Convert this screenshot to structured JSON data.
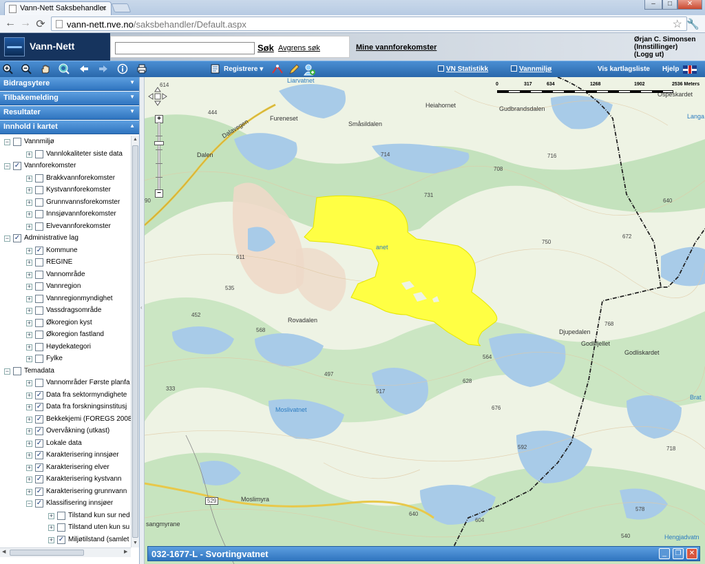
{
  "browser": {
    "tab_title": "Vann-Nett Saksbehandler",
    "tab_close": "×",
    "url_host": "vann-nett.nve.no",
    "url_path": "/saksbehandler/Default.aspx",
    "win_min": "–",
    "win_max": "□",
    "win_close": "✕",
    "back": "←",
    "forward": "→",
    "reload": "⟳",
    "star": "☆",
    "wrench": "🔧"
  },
  "header": {
    "logo_text": "Vann-Nett",
    "search_value": "",
    "search_button": "Søk",
    "refine_link": "Avgrens søk",
    "mine_link": "Mine vannforekomster",
    "user_name": "Ørjan C. Simonsen",
    "user_settings": "(Innstillinger)",
    "user_logout": "(Logg ut)"
  },
  "toolbar": {
    "registrere": "Registrere",
    "vn_statistikk": "VN Statistikk",
    "vannmiljo": "Vannmiljø",
    "vis_kartlagsliste": "Vis kartlagsliste",
    "hjelp": "Hjelp"
  },
  "accordion": [
    {
      "label": "Bidragsytere"
    },
    {
      "label": "Tilbakemelding"
    },
    {
      "label": "Resultater"
    },
    {
      "label": "Innhold i kartet"
    }
  ],
  "tree": [
    {
      "label": "Vannmiljø",
      "level": 0,
      "checked": false
    },
    {
      "label": "Vannlokaliteter siste data",
      "level": 1,
      "checked": false
    },
    {
      "label": "Vannforekomster",
      "level": 0,
      "checked": true
    },
    {
      "label": "Brakkvannforekomster",
      "level": 1,
      "checked": false
    },
    {
      "label": "Kystvannforekomster",
      "level": 1,
      "checked": false
    },
    {
      "label": "Grunnvannsforekomster",
      "level": 1,
      "checked": false
    },
    {
      "label": "Innsjøvannforekomster",
      "level": 1,
      "checked": false
    },
    {
      "label": "Elvevannforekomster",
      "level": 1,
      "checked": false
    },
    {
      "label": "Administrative lag",
      "level": 0,
      "checked": true
    },
    {
      "label": "Kommune",
      "level": 1,
      "checked": true
    },
    {
      "label": "REGINE",
      "level": 1,
      "checked": false
    },
    {
      "label": "Vannområde",
      "level": 1,
      "checked": false
    },
    {
      "label": "Vannregion",
      "level": 1,
      "checked": false
    },
    {
      "label": "Vannregionmyndighet",
      "level": 1,
      "checked": false
    },
    {
      "label": "Vassdragsområde",
      "level": 1,
      "checked": false
    },
    {
      "label": "Økoregion kyst",
      "level": 1,
      "checked": false
    },
    {
      "label": "Økoregion fastland",
      "level": 1,
      "checked": false
    },
    {
      "label": "Høydekategori",
      "level": 1,
      "checked": false
    },
    {
      "label": "Fylke",
      "level": 1,
      "checked": false
    },
    {
      "label": "Temadata",
      "level": 0,
      "checked": false
    },
    {
      "label": "Vannområder Første planfa",
      "level": 1,
      "checked": false
    },
    {
      "label": "Data fra sektormyndighete",
      "level": 1,
      "checked": true
    },
    {
      "label": "Data fra forskningsinstitusj",
      "level": 1,
      "checked": true
    },
    {
      "label": "Bekkekjemi (FOREGS 2008",
      "level": 1,
      "checked": true
    },
    {
      "label": "Overvåkning (utkast)",
      "level": 1,
      "checked": true
    },
    {
      "label": "Lokale data",
      "level": 1,
      "checked": true
    },
    {
      "label": "Karakterisering innsjøer",
      "level": 1,
      "checked": true
    },
    {
      "label": "Karakterisering elver",
      "level": 1,
      "checked": true
    },
    {
      "label": "Karakterisering kystvann",
      "level": 1,
      "checked": true
    },
    {
      "label": "Karakterisering grunnvann",
      "level": 1,
      "checked": true
    },
    {
      "label": "Klassifisering innsjøer",
      "level": 1,
      "checked": true,
      "expanded": true
    },
    {
      "label": "Tilstand kun sur ned",
      "level": 2,
      "checked": false
    },
    {
      "label": "Tilstand uten kun su",
      "level": 2,
      "checked": false
    },
    {
      "label": "Miljøtilstand (samlet",
      "level": 2,
      "checked": true
    }
  ],
  "map": {
    "scale_labels": [
      "0",
      "317",
      "634",
      "1268",
      "1902",
      "2536 Meters"
    ],
    "place_labels": [
      {
        "text": "Liarvatnet",
        "kind": "water"
      },
      {
        "text": "Heiahornet",
        "kind": "place"
      },
      {
        "text": "Gudbrandsdalen",
        "kind": "place"
      },
      {
        "text": "Ospeskardet",
        "kind": "place"
      },
      {
        "text": "Langa",
        "kind": "water"
      },
      {
        "text": "Fureneset",
        "kind": "place"
      },
      {
        "text": "Småsildalen",
        "kind": "place"
      },
      {
        "text": "Dalavegen",
        "kind": "place"
      },
      {
        "text": "Dalen",
        "kind": "place"
      },
      {
        "text": "Rovadalen",
        "kind": "place"
      },
      {
        "text": "Djupedalen",
        "kind": "place"
      },
      {
        "text": "Godlifjellet",
        "kind": "place"
      },
      {
        "text": "Godliskardet",
        "kind": "place"
      },
      {
        "text": "Moslivatnet",
        "kind": "water"
      },
      {
        "text": "Moslimyra",
        "kind": "place"
      },
      {
        "text": "sangmyrane",
        "kind": "place"
      },
      {
        "text": "Hengjadvatn",
        "kind": "water"
      },
      {
        "text": "Brat",
        "kind": "water"
      },
      {
        "text": "anet",
        "kind": "water"
      }
    ],
    "height_labels": [
      "614",
      "444",
      "714",
      "708",
      "716",
      "731",
      "640",
      "672",
      "750",
      "611",
      "535",
      "452",
      "568",
      "497",
      "517",
      "564",
      "628",
      "676",
      "768",
      "333",
      "592",
      "718",
      "640",
      "604",
      "540",
      "578",
      "529",
      "90"
    ]
  },
  "infobar": {
    "title": "032-1677-L - Svortingvatnet"
  },
  "colors": {
    "toolbar": "#3a7cc2",
    "highlight": "#ffff44",
    "water": "#a8cbe8",
    "forest": "#b8dcb0"
  }
}
